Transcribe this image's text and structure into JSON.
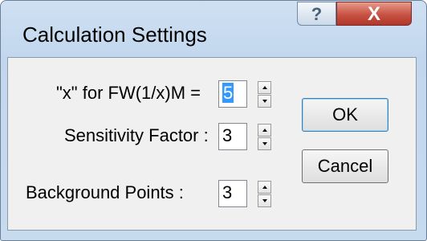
{
  "window": {
    "title": "Calculation Settings"
  },
  "title_buttons": {
    "help": "?",
    "close": "X"
  },
  "fields": [
    {
      "label": "\"x\" for FW(1/x)M =",
      "value": "5"
    },
    {
      "label": "Sensitivity Factor :",
      "value": "3"
    },
    {
      "label": "Background Points :",
      "value": "3"
    }
  ],
  "buttons": {
    "ok": "OK",
    "cancel": "Cancel"
  }
}
